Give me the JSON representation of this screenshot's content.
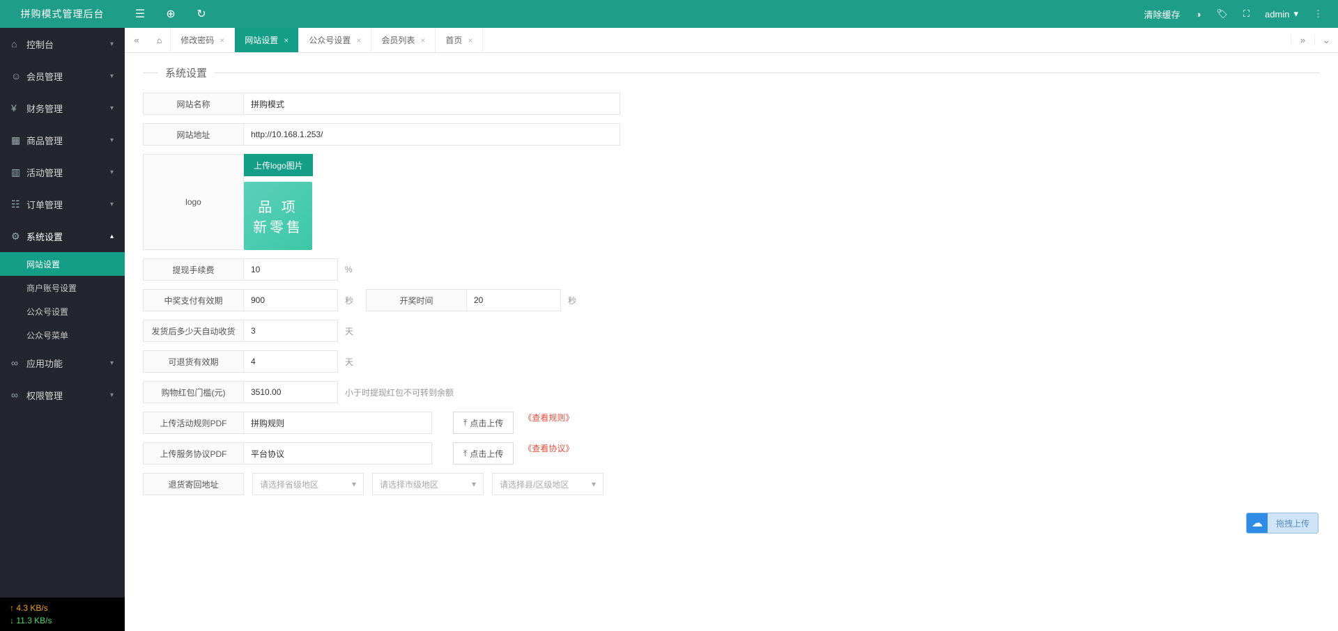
{
  "brand": "拼购模式管理后台",
  "header": {
    "clear_cache": "清除缓存",
    "admin": "admin"
  },
  "sidebar": {
    "items": [
      {
        "icon": "⌂",
        "label": "控制台"
      },
      {
        "icon": "👤",
        "label": "会员管理"
      },
      {
        "icon": "¥",
        "label": "财务管理"
      },
      {
        "icon": "▦",
        "label": "商品管理"
      },
      {
        "icon": "🎁",
        "label": "活动管理"
      },
      {
        "icon": "☷",
        "label": "订单管理"
      },
      {
        "icon": "⚙",
        "label": "系统设置"
      },
      {
        "icon": "∞",
        "label": "应用功能"
      },
      {
        "icon": "∞",
        "label": "权限管理"
      }
    ],
    "sub": [
      {
        "label": "网站设置",
        "sel": true
      },
      {
        "label": "商户账号设置"
      },
      {
        "label": "公众号设置"
      },
      {
        "label": "公众号菜单"
      }
    ]
  },
  "tabs": [
    {
      "label": "修改密码"
    },
    {
      "label": "网站设置",
      "active": true
    },
    {
      "label": "公众号设置"
    },
    {
      "label": "会员列表"
    },
    {
      "label": "首页"
    }
  ],
  "section_title": "系统设置",
  "form": {
    "site_name_label": "网站名称",
    "site_name": "拼购模式",
    "site_url_label": "网站地址",
    "site_url": "http://10.168.1.253/",
    "logo_label": "logo",
    "logo_btn": "上传logo图片",
    "logo_line1": "品 项",
    "logo_line2": "新零售",
    "withdraw_fee_label": "提现手续费",
    "withdraw_fee": "10",
    "pct": "%",
    "pay_valid_label": "中奖支付有效期",
    "pay_valid": "900",
    "sec": "秒",
    "open_time_label": "开奖时间",
    "open_time": "20",
    "auto_receive_label": "发货后多少天自动收货",
    "auto_receive": "3",
    "day": "天",
    "refund_valid_label": "可退货有效期",
    "refund_valid": "4",
    "red_threshold_label": "购物红包门槛(元)",
    "red_threshold": "3510.00",
    "red_hint": "小于时提现红包不可转到余额",
    "rule_pdf_label": "上传活动规则PDF",
    "rule_pdf": "拼购规则",
    "upload_btn": "点击上传",
    "view_rule": "《查看规则》",
    "svc_pdf_label": "上传服务协议PDF",
    "svc_pdf": "平台协议",
    "view_svc": "《查看协议》",
    "return_addr_label": "退货寄回地址",
    "sel_province": "请选择省级地区",
    "sel_city": "请选择市级地区",
    "sel_county": "请选择县/区级地区"
  },
  "netstat": {
    "up": "↑ 4.3 KB/s",
    "dn": "↓ 11.3 KB/s"
  },
  "cloud_upload": "拖拽上传"
}
